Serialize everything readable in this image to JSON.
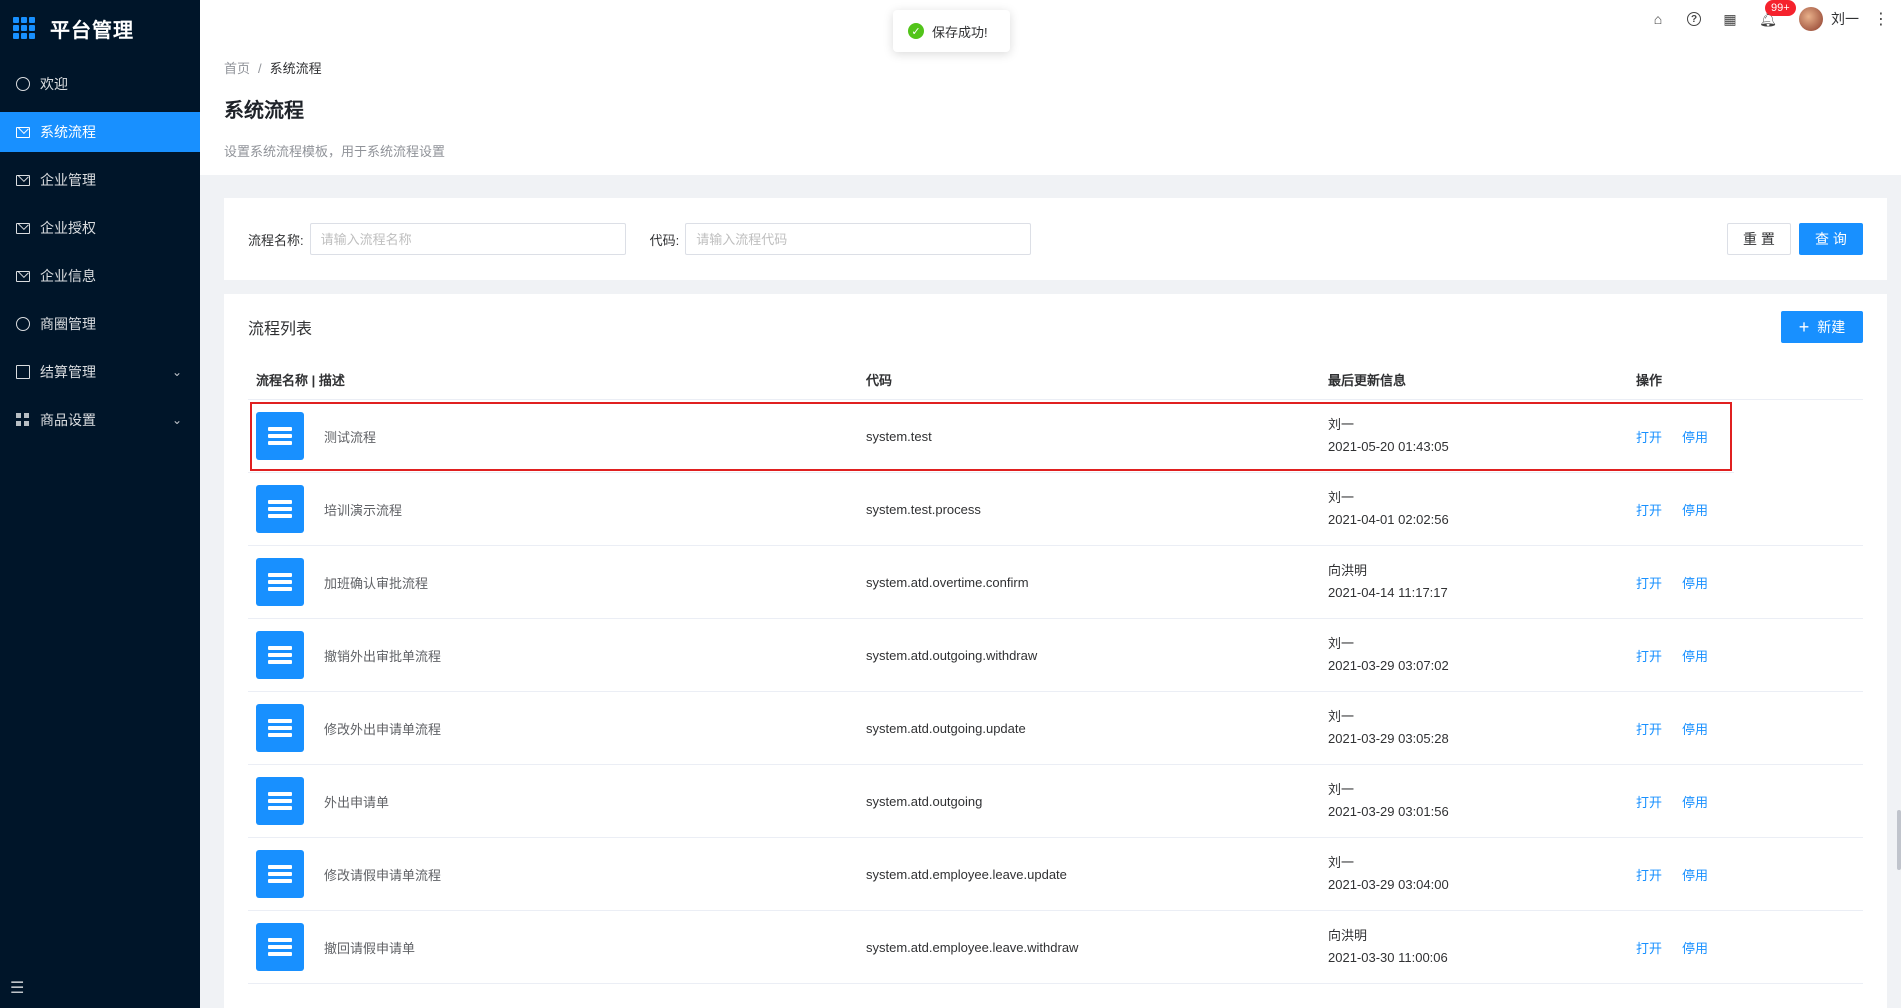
{
  "sidebar": {
    "title": "平台管理",
    "items": [
      {
        "label": "欢迎"
      },
      {
        "label": "系统流程"
      },
      {
        "label": "企业管理"
      },
      {
        "label": "企业授权"
      },
      {
        "label": "企业信息"
      },
      {
        "label": "商圈管理"
      },
      {
        "label": "结算管理"
      },
      {
        "label": "商品设置"
      }
    ]
  },
  "header": {
    "badge": "99+",
    "username": "刘一"
  },
  "toast": {
    "message": "保存成功!"
  },
  "breadcrumb": {
    "home": "首页",
    "sep": "/",
    "current": "系统流程"
  },
  "page": {
    "title": "系统流程",
    "description": "设置系统流程模板，用于系统流程设置"
  },
  "search": {
    "name_label": "流程名称:",
    "name_placeholder": "请输入流程名称",
    "code_label": "代码:",
    "code_placeholder": "请输入流程代码",
    "reset_label": "重 置",
    "query_label": "查 询"
  },
  "list": {
    "title": "流程列表",
    "new_label": "新建",
    "columns": {
      "name": "流程名称 | 描述",
      "code": "代码",
      "updated": "最后更新信息",
      "actions": "操作"
    },
    "open_label": "打开",
    "disable_label": "停用",
    "rows": [
      {
        "name": "测试流程",
        "code": "system.test",
        "user": "刘一",
        "time": "2021-05-20 01:43:05"
      },
      {
        "name": "培训演示流程",
        "code": "system.test.process",
        "user": "刘一",
        "time": "2021-04-01 02:02:56"
      },
      {
        "name": "加班确认审批流程",
        "code": "system.atd.overtime.confirm",
        "user": "向洪明",
        "time": "2021-04-14 11:17:17"
      },
      {
        "name": "撤销外出审批单流程",
        "code": "system.atd.outgoing.withdraw",
        "user": "刘一",
        "time": "2021-03-29 03:07:02"
      },
      {
        "name": "修改外出申请单流程",
        "code": "system.atd.outgoing.update",
        "user": "刘一",
        "time": "2021-03-29 03:05:28"
      },
      {
        "name": "外出申请单",
        "code": "system.atd.outgoing",
        "user": "刘一",
        "time": "2021-03-29 03:01:56"
      },
      {
        "name": "修改请假申请单流程",
        "code": "system.atd.employee.leave.update",
        "user": "刘一",
        "time": "2021-03-29 03:04:00"
      },
      {
        "name": "撤回请假申请单",
        "code": "system.atd.employee.leave.withdraw",
        "user": "向洪明",
        "time": "2021-03-30 11:00:06"
      }
    ]
  }
}
